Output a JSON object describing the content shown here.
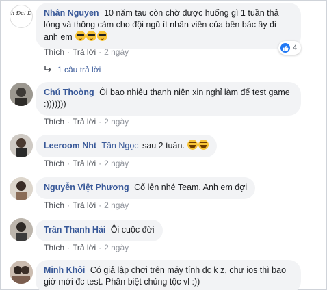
{
  "comments": [
    {
      "name": "Nhân Nguyen",
      "avatar_text": "Anh Đại Diện",
      "text": "10 năm tau còn chờ được huống gì 1 tuần thả lỏng và thông cảm cho đội ngũ ít nhân viên của bên bác ấy đi anh em",
      "emojis": [
        "sunglasses-emoji",
        "sunglasses-emoji",
        "sunglasses-emoji"
      ],
      "like": "Thích",
      "reply": "Trả lời",
      "time": "2 ngày",
      "reaction_count": "4",
      "reply_count_label": "1 câu trả lời"
    },
    {
      "name": "Chú Thoòng",
      "text": "Ôi bao nhiêu thanh niên xin nghỉ làm để test game :)))))))",
      "like": "Thích",
      "reply": "Trả lời",
      "time": "2 ngày"
    },
    {
      "name": "Leeroom Nht",
      "tag": "Tân Ngọc",
      "text": "sau 2 tuần.",
      "emojis": [
        "laughing-emoji",
        "laughing-emoji"
      ],
      "like": "Thích",
      "reply": "Trả lời",
      "time": "2 ngày"
    },
    {
      "name": "Nguyễn Việt Phương",
      "text": "Cố lên nhé Team. Anh em đợi",
      "like": "Thích",
      "reply": "Trả lời",
      "time": "2 ngày"
    },
    {
      "name": "Trần Thanh Hải",
      "text": "Ôi cuộc đời",
      "like": "Thích",
      "reply": "Trả lời",
      "time": "2 ngày"
    },
    {
      "name": "Minh Khôi",
      "text": "Có giả lập chơi trên máy tính đc k z, chư ios thì bao giờ mới đc test. Phân biệt chủng tộc vl :))"
    }
  ],
  "colors": {
    "name": "#385898",
    "bubble": "#f2f3f5",
    "meta": "#90949c",
    "like_badge": "#2078f4"
  }
}
